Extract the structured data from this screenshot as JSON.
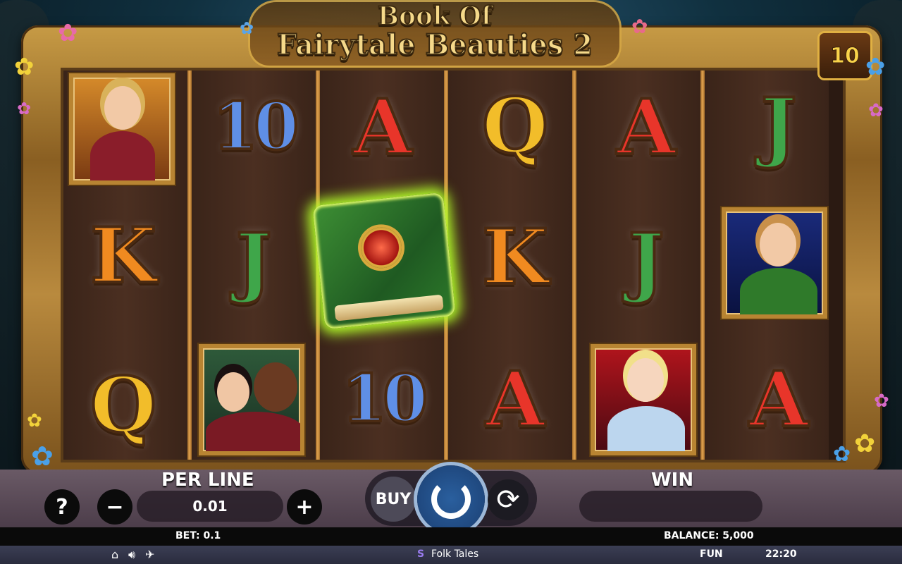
{
  "game": {
    "title_line1": "Book Of",
    "title_line2": "Fairytale Beauties 2",
    "lines_badge": "10"
  },
  "reels": {
    "grid": [
      [
        "portrait-red-riding-hood",
        "K",
        "Q"
      ],
      [
        "10",
        "J",
        "portrait-beauty-and-beast"
      ],
      [
        "A",
        "book",
        "10"
      ],
      [
        "Q",
        "K",
        "A"
      ],
      [
        "A",
        "J",
        "portrait-cinderella"
      ],
      [
        "J",
        "portrait-green-dress",
        "A"
      ]
    ]
  },
  "controls": {
    "help_label": "?",
    "minus_label": "−",
    "plus_label": "+",
    "per_line_label": "PER LINE",
    "per_line_value": "0.01",
    "buy_label": "BUY",
    "win_label": "WIN",
    "win_value": ""
  },
  "status": {
    "bet": "BET: 0.1",
    "balance": "BALANCE: 5,000",
    "mode": "FUN",
    "time": "22:20",
    "provider": "Folk Tales"
  }
}
